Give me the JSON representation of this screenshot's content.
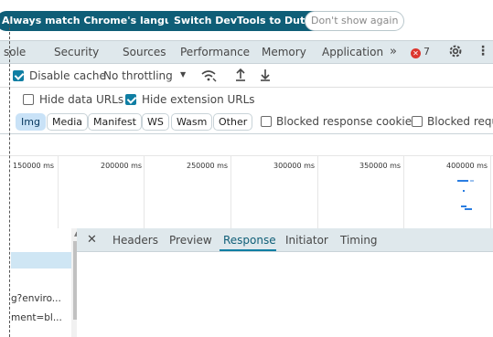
{
  "banner": {
    "match_language": "Always match Chrome's language",
    "switch_language": "Switch DevTools to Dutch",
    "dont_show": "Don't show again"
  },
  "tabs": {
    "items": [
      "sole",
      "Security",
      "Sources",
      "Performance",
      "Memory",
      "Application"
    ],
    "more": "»",
    "error_count": "7",
    "error_glyph": "✕"
  },
  "toolbar": {
    "disable_cache": "Disable cache",
    "throttling": "No throttling",
    "dropdown_glyph": "▼"
  },
  "filters": {
    "hide_data_urls": "Hide data URLs",
    "hide_extension_urls": "Hide extension URLs",
    "types": [
      "Img",
      "Media",
      "Manifest",
      "WS",
      "Wasm",
      "Other"
    ],
    "blocked_cookies": "Blocked response cookies",
    "blocked_requests": "Blocked reque"
  },
  "timeline": {
    "ticks": [
      "150000 ms",
      "200000 ms",
      "250000 ms",
      "300000 ms",
      "350000 ms",
      "400000 ms"
    ]
  },
  "requests": {
    "rows": [
      "g?enviro...",
      "ment=bl..."
    ]
  },
  "detail": {
    "close_glyph": "✕",
    "tabs": [
      "Headers",
      "Preview",
      "Response",
      "Initiator",
      "Timing"
    ],
    "active_tab": "Response"
  },
  "colors": {
    "accent": "#0f5e77",
    "toolbar_bg": "#dfe8ec",
    "selected_filter": "#c9e2f7",
    "error": "#dc362e"
  }
}
